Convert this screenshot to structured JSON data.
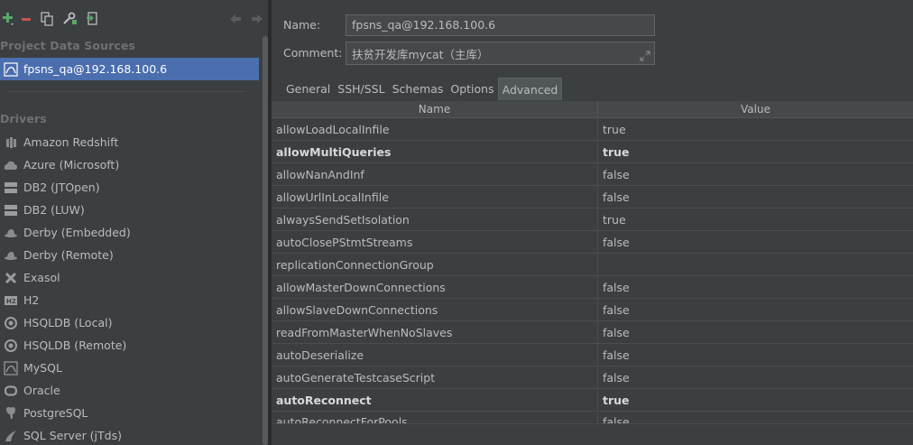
{
  "toolbar": {
    "icons": [
      "add-icon",
      "remove-icon",
      "copy-icon",
      "properties-icon",
      "import-icon",
      "back-icon",
      "forward-icon"
    ]
  },
  "left": {
    "project_title": "Project Data Sources",
    "selected_source": "fpsns_qa@192.168.100.6",
    "drivers_title": "Drivers",
    "drivers": [
      {
        "label": "Amazon Redshift",
        "icon": "redshift-icon"
      },
      {
        "label": "Azure (Microsoft)",
        "icon": "azure-icon"
      },
      {
        "label": "DB2 (JTOpen)",
        "icon": "ibm-db2-icon"
      },
      {
        "label": "DB2 (LUW)",
        "icon": "ibm-db2-icon"
      },
      {
        "label": "Derby (Embedded)",
        "icon": "derby-icon"
      },
      {
        "label": "Derby (Remote)",
        "icon": "derby-icon"
      },
      {
        "label": "Exasol",
        "icon": "exasol-icon"
      },
      {
        "label": "H2",
        "icon": "h2-icon"
      },
      {
        "label": "HSQLDB (Local)",
        "icon": "hsqldb-icon"
      },
      {
        "label": "HSQLDB (Remote)",
        "icon": "hsqldb-icon"
      },
      {
        "label": "MySQL",
        "icon": "mysql-icon"
      },
      {
        "label": "Oracle",
        "icon": "oracle-icon"
      },
      {
        "label": "PostgreSQL",
        "icon": "postgresql-icon"
      },
      {
        "label": "SQL Server (jTds)",
        "icon": "sqlserver-icon"
      }
    ]
  },
  "form": {
    "name_label": "Name:",
    "name_value": "fpsns_qa@192.168.100.6",
    "comment_label": "Comment:",
    "comment_value": "扶贫开发库mycat（主库）"
  },
  "tabs": [
    "General",
    "SSH/SSL",
    "Schemas",
    "Options",
    "Advanced"
  ],
  "active_tab": "Advanced",
  "table": {
    "headers": {
      "name": "Name",
      "value": "Value"
    },
    "rows": [
      {
        "name": "allowLoadLocalInfile",
        "value": "true",
        "modified": false
      },
      {
        "name": "allowMultiQueries",
        "value": "true",
        "modified": true
      },
      {
        "name": "allowNanAndInf",
        "value": "false",
        "modified": false
      },
      {
        "name": "allowUrlInLocalInfile",
        "value": "false",
        "modified": false
      },
      {
        "name": "alwaysSendSetIsolation",
        "value": "true",
        "modified": false
      },
      {
        "name": "autoClosePStmtStreams",
        "value": "false",
        "modified": false
      },
      {
        "name": "replicationConnectionGroup",
        "value": "",
        "modified": false
      },
      {
        "name": "allowMasterDownConnections",
        "value": "false",
        "modified": false
      },
      {
        "name": "allowSlaveDownConnections",
        "value": "false",
        "modified": false
      },
      {
        "name": "readFromMasterWhenNoSlaves",
        "value": "false",
        "modified": false
      },
      {
        "name": "autoDeserialize",
        "value": "false",
        "modified": false
      },
      {
        "name": "autoGenerateTestcaseScript",
        "value": "false",
        "modified": false
      },
      {
        "name": "autoReconnect",
        "value": "true",
        "modified": true
      },
      {
        "name": "autoReconnectForPools",
        "value": "false",
        "modified": false
      }
    ]
  },
  "colors": {
    "background": "#3c3f41",
    "selection": "#4b6eaf",
    "add_green": "#59a869",
    "remove_red": "#c75450"
  }
}
